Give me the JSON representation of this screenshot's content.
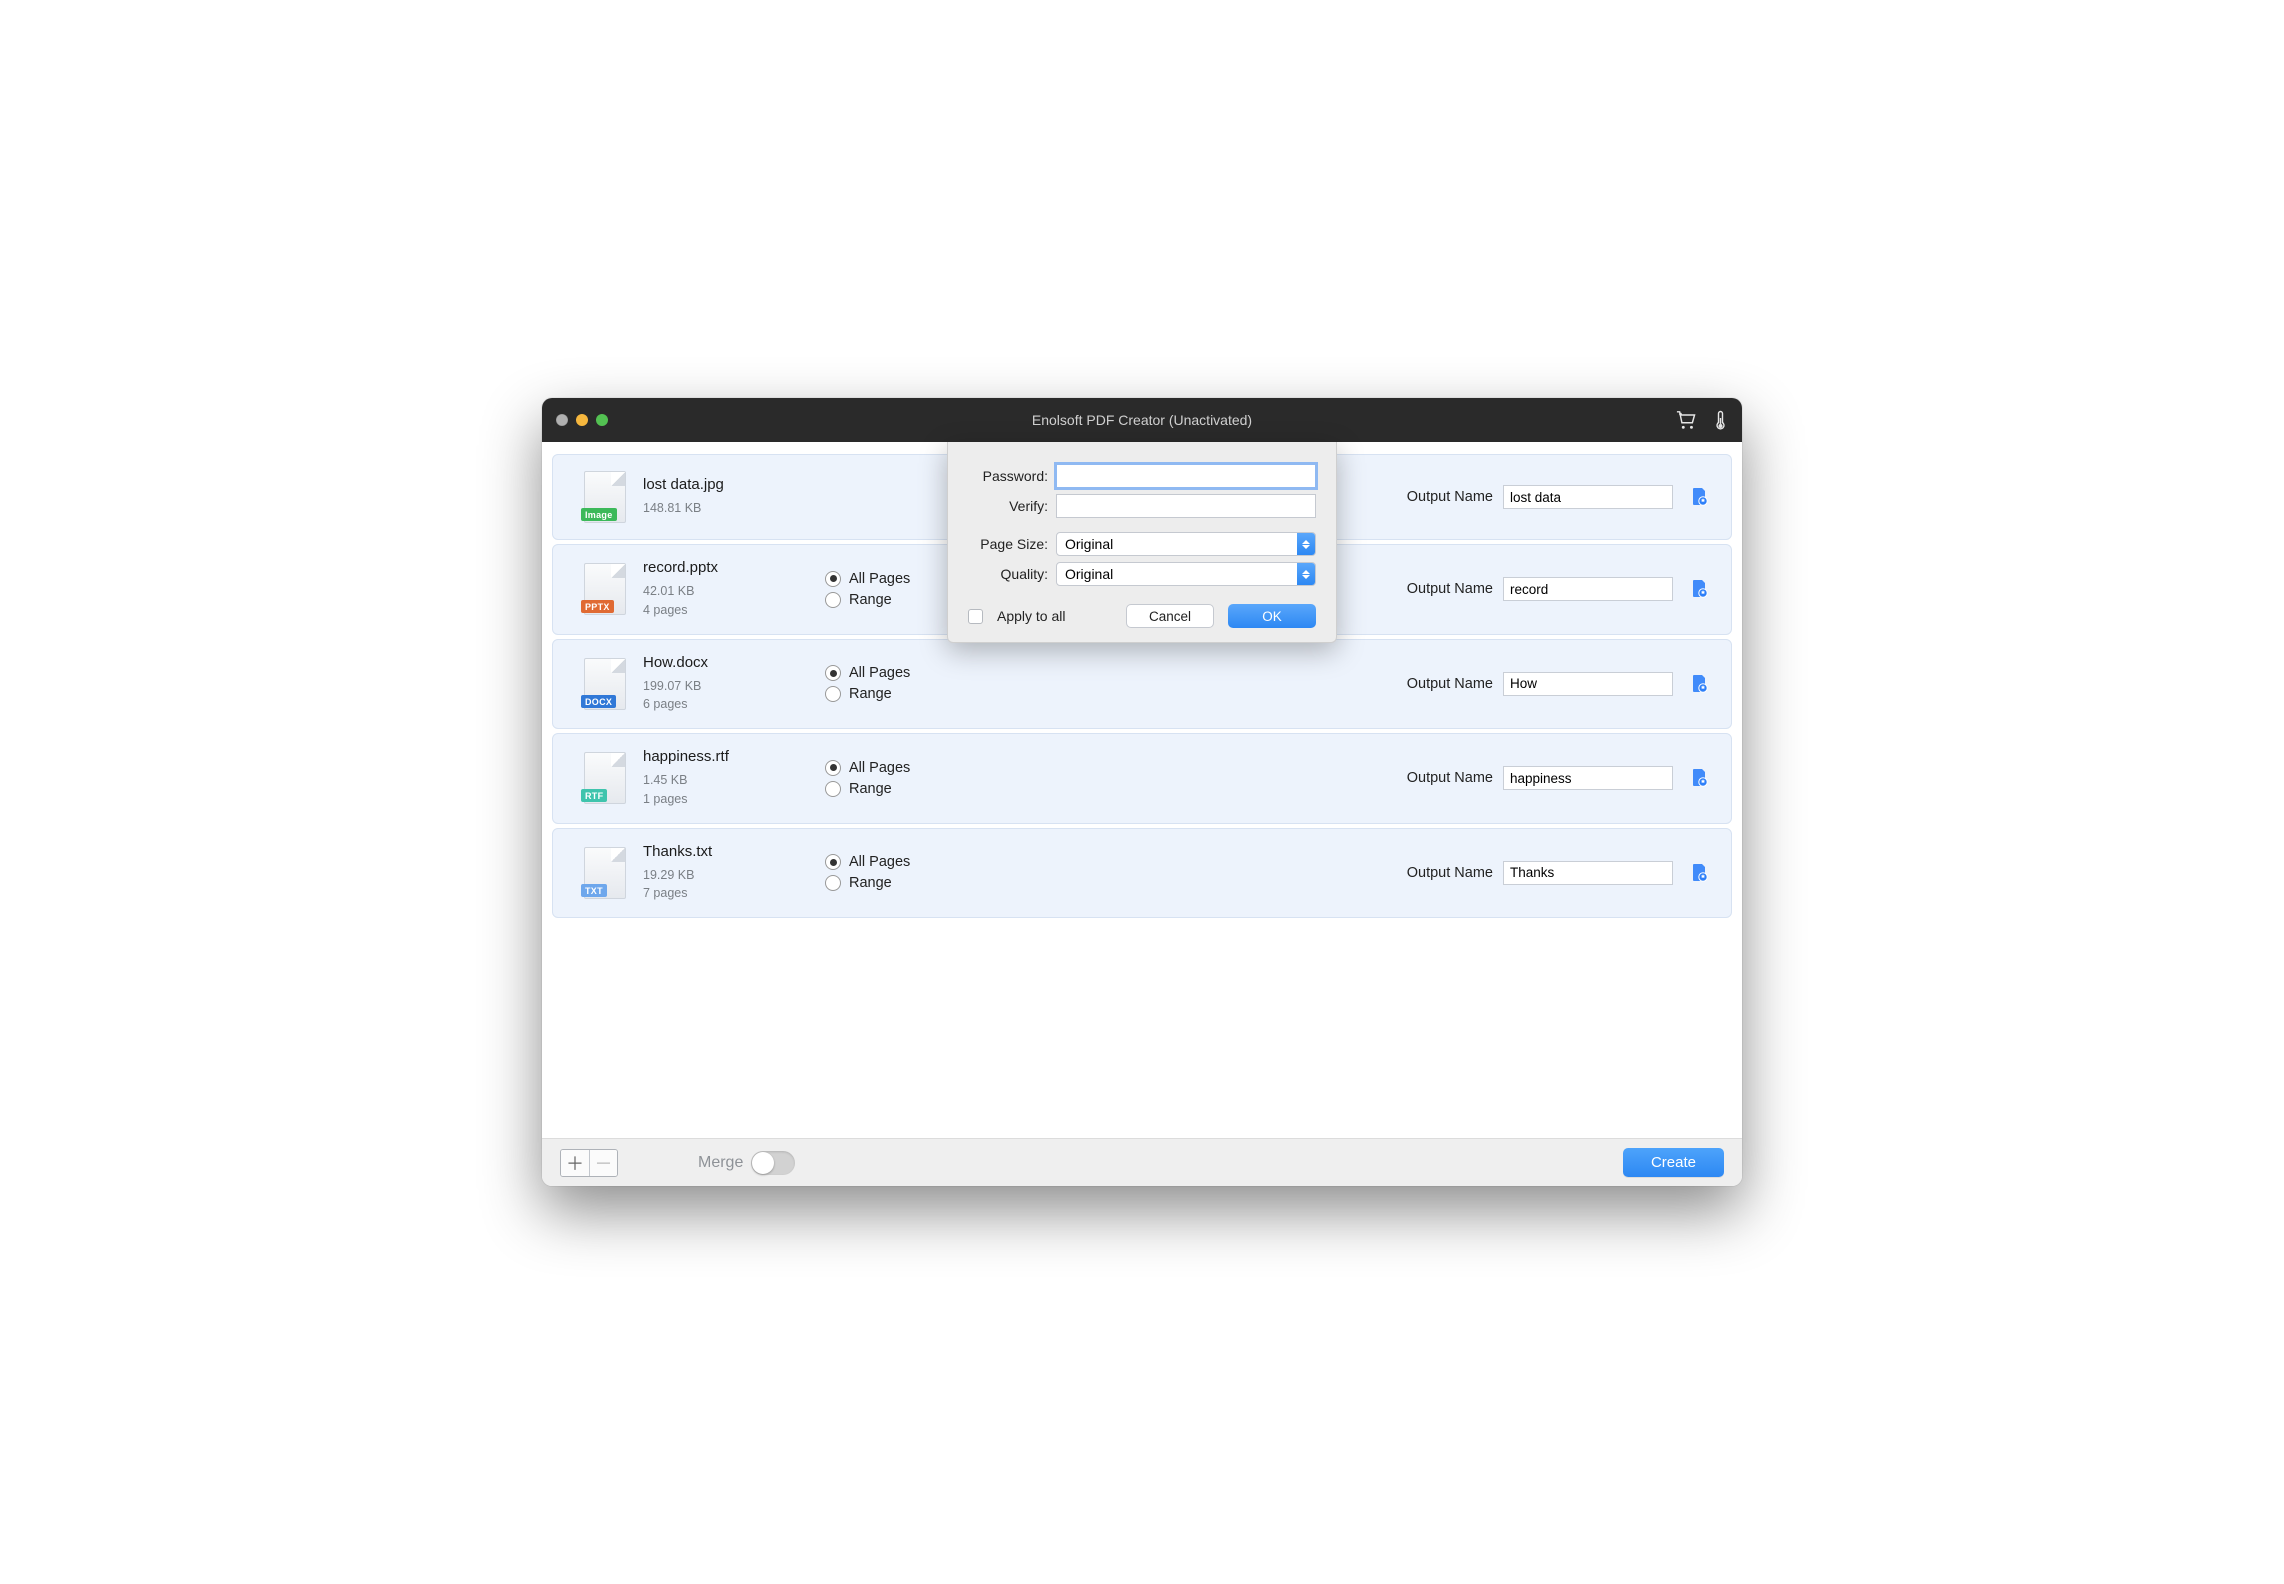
{
  "titlebar": {
    "title": "Enolsoft PDF Creator (Unactivated)"
  },
  "files": [
    {
      "icon_label": "Image",
      "icon_color": "#3cb95a",
      "name": "lost data.jpg",
      "size": "148.81 KB",
      "pages": "",
      "output": "lost data"
    },
    {
      "icon_label": "PPTX",
      "icon_color": "#e06a33",
      "name": "record.pptx",
      "size": "42.01 KB",
      "pages": "4 pages",
      "output": "record"
    },
    {
      "icon_label": "DOCX",
      "icon_color": "#3078d7",
      "name": "How.docx",
      "size": "199.07 KB",
      "pages": "6 pages",
      "output": "How"
    },
    {
      "icon_label": "RTF",
      "icon_color": "#3fc4ad",
      "name": "happiness.rtf",
      "size": "1.45 KB",
      "pages": "1 pages",
      "output": "happiness"
    },
    {
      "icon_label": "TXT",
      "icon_color": "#6ea7ec",
      "name": "Thanks.txt",
      "size": "19.29 KB",
      "pages": "7 pages",
      "output": "Thanks"
    }
  ],
  "row_labels": {
    "all_pages": "All Pages",
    "range": "Range",
    "output_name": "Output Name"
  },
  "footer": {
    "merge": "Merge",
    "create": "Create"
  },
  "dialog": {
    "password_label": "Password:",
    "verify_label": "Verify:",
    "pagesize_label": "Page Size:",
    "pagesize_value": "Original",
    "quality_label": "Quality:",
    "quality_value": "Original",
    "apply_all": "Apply to all",
    "cancel": "Cancel",
    "ok": "OK"
  }
}
